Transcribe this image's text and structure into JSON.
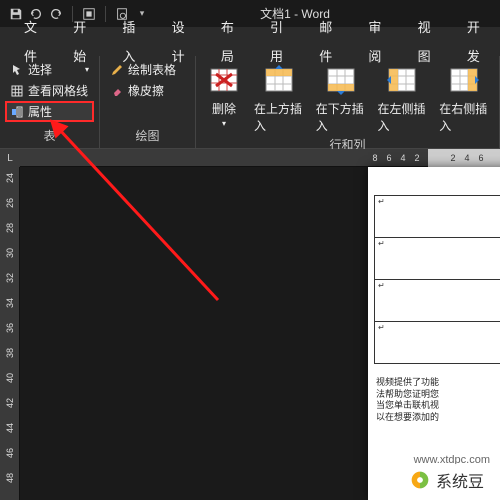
{
  "title": "文档1 - Word",
  "menus": {
    "file": "文件",
    "home": "开始",
    "insert": "插入",
    "design": "设计",
    "layout": "布局",
    "ref": "引用",
    "mail": "邮件",
    "review": "审阅",
    "view": "视图",
    "dev": "开发"
  },
  "ribbon": {
    "table_group": "表",
    "draw_group": "绘图",
    "rowcol_group": "行和列",
    "select": "选择",
    "gridlines": "查看网格线",
    "properties": "属性",
    "draw_table": "绘制表格",
    "eraser": "橡皮擦",
    "delete": "删除",
    "ins_above": "在上方插入",
    "ins_below": "在下方插入",
    "ins_left": "在左侧插入",
    "ins_right": "在右侧插入"
  },
  "ruler": {
    "left": [
      "8",
      "6",
      "4",
      "2"
    ],
    "right": [
      "2",
      "4",
      "6"
    ],
    "v": [
      "24",
      "26",
      "28",
      "30",
      "32",
      "34",
      "36",
      "38",
      "40",
      "42",
      "44",
      "46",
      "48"
    ]
  },
  "doc": {
    "para1": "视频提供了功能",
    "para2": "法帮助您证明您",
    "para3": "当您单击联机视",
    "para4": "以在想要添加的"
  },
  "watermark": {
    "text": "系统豆",
    "url": "www.xtdpc.com"
  }
}
